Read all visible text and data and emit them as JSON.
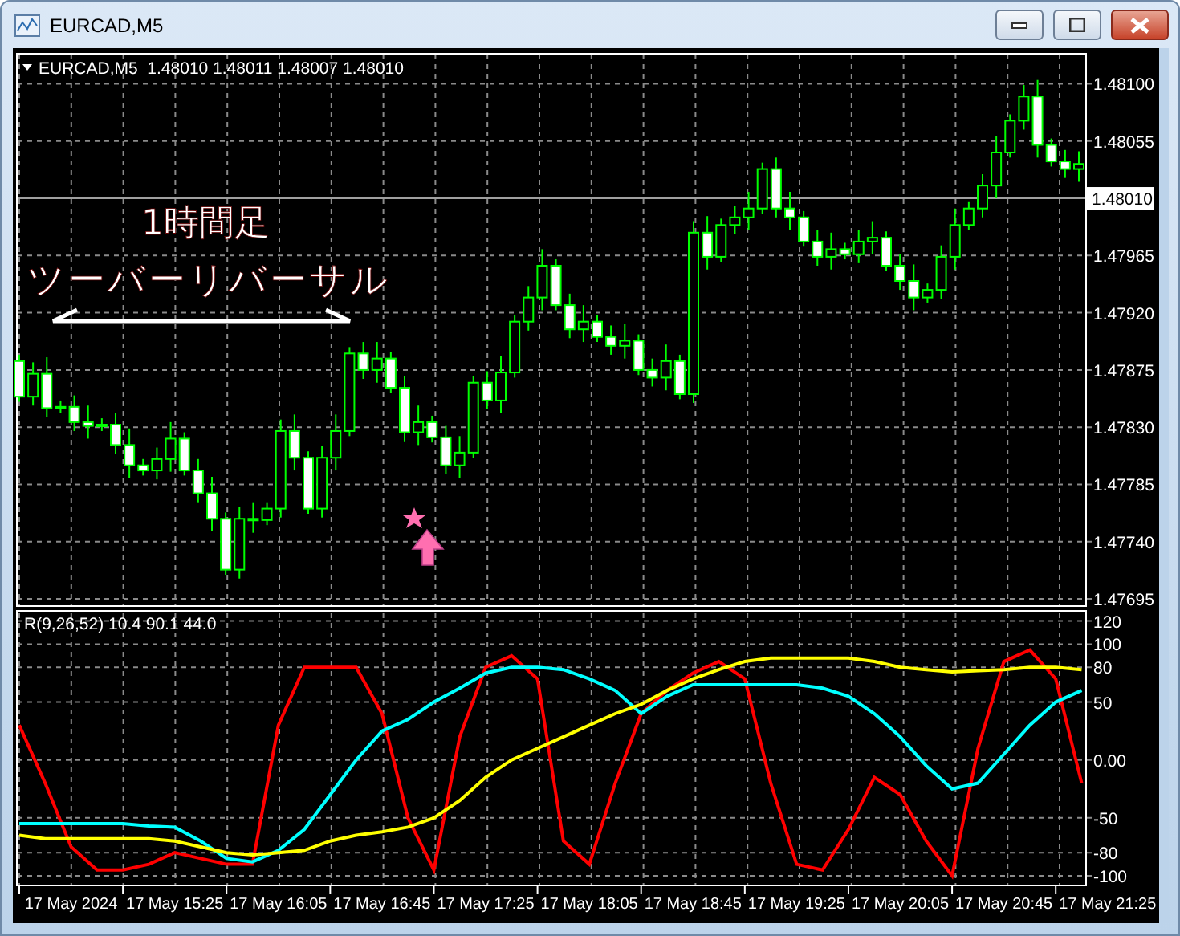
{
  "window": {
    "title": "EURCAD,M5"
  },
  "price_chart": {
    "header": "EURCAD,M5  1.48010 1.48011 1.48007 1.48010",
    "annotation_title": "1時間足",
    "annotation_caption": "ツーバーリバーサル",
    "chart_data": {
      "type": "candlestick",
      "categories": [
        null,
        null,
        null,
        null,
        null,
        null,
        null,
        null,
        null,
        null,
        null,
        null,
        null,
        null,
        null,
        null,
        null,
        null,
        null,
        null,
        null,
        null,
        null,
        null,
        null,
        null,
        null,
        null,
        null,
        null,
        null,
        null,
        null,
        null,
        null,
        null,
        null,
        null,
        null,
        null,
        null,
        null,
        null,
        null,
        null,
        null,
        null,
        null,
        null,
        null,
        null,
        null,
        null,
        null,
        null,
        null,
        null,
        null,
        null,
        null,
        null,
        null,
        null,
        null,
        null,
        null,
        null,
        null,
        null,
        null,
        null,
        null,
        null,
        null,
        null,
        null,
        null,
        null
      ],
      "grid": true,
      "ylim": [
        1.4769,
        1.48123
      ],
      "yticks": [
        {
          "value": 1.481,
          "label": "1.48100"
        },
        {
          "value": 1.48055,
          "label": "1.48055"
        },
        {
          "value": 1.47965,
          "label": "1.47965"
        },
        {
          "value": 1.4792,
          "label": "1.47920"
        },
        {
          "value": 1.47875,
          "label": "1.47875"
        },
        {
          "value": 1.4783,
          "label": "1.47830"
        },
        {
          "value": 1.47785,
          "label": "1.47785"
        },
        {
          "value": 1.4774,
          "label": "1.47740"
        },
        {
          "value": 1.47695,
          "label": "1.47695"
        }
      ],
      "ohlc": [
        [
          1.47882,
          1.47887,
          1.4785,
          1.47854
        ],
        [
          1.47854,
          1.47881,
          1.47847,
          1.47872
        ],
        [
          1.47872,
          1.47885,
          1.47838,
          1.47845
        ],
        [
          1.47845,
          1.47851,
          1.47841,
          1.47846
        ],
        [
          1.47846,
          1.47855,
          1.47827,
          1.47834
        ],
        [
          1.47834,
          1.47847,
          1.47821,
          1.47831
        ],
        [
          1.47831,
          1.47837,
          1.47827,
          1.47832
        ],
        [
          1.47832,
          1.47841,
          1.47809,
          1.47816
        ],
        [
          1.47816,
          1.47829,
          1.4779,
          1.478
        ],
        [
          1.478,
          1.47805,
          1.47792,
          1.47796
        ],
        [
          1.47796,
          1.47814,
          1.47789,
          1.47805
        ],
        [
          1.47805,
          1.47834,
          1.47795,
          1.47821
        ],
        [
          1.47821,
          1.47826,
          1.47792,
          1.47796
        ],
        [
          1.47796,
          1.47805,
          1.47771,
          1.47778
        ],
        [
          1.47778,
          1.47791,
          1.47748,
          1.47758
        ],
        [
          1.47758,
          1.47763,
          1.47714,
          1.47718
        ],
        [
          1.47718,
          1.47767,
          1.47711,
          1.47758
        ],
        [
          1.47758,
          1.47771,
          1.47747,
          1.47757
        ],
        [
          1.47757,
          1.47771,
          1.47753,
          1.47766
        ],
        [
          1.47766,
          1.47836,
          1.47759,
          1.47827
        ],
        [
          1.47827,
          1.4784,
          1.47796,
          1.47806
        ],
        [
          1.47806,
          1.47811,
          1.47762,
          1.47766
        ],
        [
          1.47766,
          1.47815,
          1.47759,
          1.47806
        ],
        [
          1.47806,
          1.4784,
          1.47796,
          1.47827
        ],
        [
          1.47827,
          1.47893,
          1.47823,
          1.47888
        ],
        [
          1.47888,
          1.47897,
          1.47868,
          1.47875
        ],
        [
          1.47875,
          1.47897,
          1.47865,
          1.47884
        ],
        [
          1.47884,
          1.47889,
          1.47857,
          1.47861
        ],
        [
          1.47861,
          1.4787,
          1.47819,
          1.47826
        ],
        [
          1.47826,
          1.47847,
          1.47816,
          1.47834
        ],
        [
          1.47834,
          1.47839,
          1.47818,
          1.47822
        ],
        [
          1.47822,
          1.47831,
          1.47793,
          1.478
        ],
        [
          1.478,
          1.47823,
          1.4779,
          1.4781
        ],
        [
          1.4781,
          1.4787,
          1.47806,
          1.47865
        ],
        [
          1.47865,
          1.47874,
          1.47844,
          1.47851
        ],
        [
          1.47851,
          1.47886,
          1.47841,
          1.47873
        ],
        [
          1.47873,
          1.47918,
          1.47869,
          1.47913
        ],
        [
          1.47913,
          1.47941,
          1.47906,
          1.47932
        ],
        [
          1.47932,
          1.4797,
          1.47922,
          1.47957
        ],
        [
          1.47957,
          1.47962,
          1.47922,
          1.47926
        ],
        [
          1.47926,
          1.47935,
          1.479,
          1.47907
        ],
        [
          1.47907,
          1.47926,
          1.47897,
          1.47913
        ],
        [
          1.47913,
          1.47918,
          1.47897,
          1.47901
        ],
        [
          1.47901,
          1.4791,
          1.47887,
          1.47894
        ],
        [
          1.47894,
          1.47911,
          1.47884,
          1.47898
        ],
        [
          1.47898,
          1.47903,
          1.47871,
          1.47875
        ],
        [
          1.47875,
          1.47884,
          1.47862,
          1.47869
        ],
        [
          1.47869,
          1.47895,
          1.47859,
          1.47882
        ],
        [
          1.47882,
          1.47887,
          1.47852,
          1.47856
        ],
        [
          1.47856,
          1.47992,
          1.47849,
          1.47983
        ],
        [
          1.47983,
          1.47996,
          1.47954,
          1.47964
        ],
        [
          1.47964,
          1.47994,
          1.4796,
          1.47989
        ],
        [
          1.47989,
          1.48004,
          1.47982,
          1.47995
        ],
        [
          1.47995,
          1.48015,
          1.47985,
          1.48002
        ],
        [
          1.48002,
          1.48038,
          1.47998,
          1.48033
        ],
        [
          1.48033,
          1.48042,
          1.47995,
          1.48002
        ],
        [
          1.48002,
          1.48015,
          1.47985,
          1.47995
        ],
        [
          1.47995,
          1.48,
          1.47972,
          1.47976
        ],
        [
          1.47976,
          1.47985,
          1.47957,
          1.47964
        ],
        [
          1.47964,
          1.47983,
          1.47954,
          1.4797
        ],
        [
          1.4797,
          1.47975,
          1.47962,
          1.47966
        ],
        [
          1.47966,
          1.47985,
          1.47959,
          1.47976
        ],
        [
          1.47976,
          1.47992,
          1.47966,
          1.47979
        ],
        [
          1.47979,
          1.47984,
          1.47953,
          1.47957
        ],
        [
          1.47957,
          1.47966,
          1.47938,
          1.47945
        ],
        [
          1.47945,
          1.47958,
          1.47922,
          1.47932
        ],
        [
          1.47932,
          1.47943,
          1.47928,
          1.47938
        ],
        [
          1.47938,
          1.47973,
          1.47931,
          1.47964
        ],
        [
          1.47964,
          1.48002,
          1.47954,
          1.47989
        ],
        [
          1.47989,
          1.48007,
          1.47985,
          1.48002
        ],
        [
          1.48002,
          1.48029,
          1.47995,
          1.4802
        ],
        [
          1.4802,
          1.48059,
          1.4801,
          1.48046
        ],
        [
          1.48046,
          1.48076,
          1.48042,
          1.48071
        ],
        [
          1.48071,
          1.48099,
          1.48064,
          1.4809
        ],
        [
          1.4809,
          1.48103,
          1.48042,
          1.48052
        ],
        [
          1.48052,
          1.48057,
          1.48035,
          1.48039
        ],
        [
          1.48039,
          1.48048,
          1.48026,
          1.48033
        ],
        [
          1.48033,
          1.48047,
          1.48023,
          1.48037
        ]
      ],
      "ref_lines": [
        {
          "axis": "y",
          "value": 1.4801,
          "label": "1.48010"
        }
      ]
    }
  },
  "indicator": {
    "label": "R(9,26,52) 10.4 90.1 44.0",
    "chart_data": {
      "type": "line",
      "categories": [
        null,
        null,
        "17 May 2024",
        null,
        null,
        null,
        "17 May 15:25",
        null,
        null,
        null,
        "17 May 16:05",
        null,
        null,
        null,
        "17 May 16:45",
        null,
        null,
        null,
        "17 May 17:25",
        null,
        null,
        null,
        "17 May 18:05",
        null,
        null,
        null,
        "17 May 18:45",
        null,
        null,
        null,
        "17 May 19:25",
        null,
        null,
        null,
        "17 May 20:05",
        null,
        null,
        null,
        "17 May 20:45",
        null,
        null,
        null,
        "17 May 21:25"
      ],
      "grid": true,
      "series": [
        {
          "color": "#ff0000",
          "values": [
            30,
            -20,
            -75,
            -95,
            -95,
            -90,
            -80,
            -85,
            -90,
            -90,
            30,
            80,
            80,
            80,
            40,
            -50,
            -95,
            20,
            80,
            90,
            70,
            -70,
            -90,
            -20,
            40,
            60,
            75,
            85,
            70,
            -20,
            -90,
            -95,
            -60,
            -15,
            -30,
            -70,
            -100,
            10,
            85,
            95,
            70,
            -20,
            null
          ]
        },
        {
          "color": "#00ffff",
          "values": [
            -55,
            -55,
            -55,
            -55,
            -55,
            -57,
            -58,
            -70,
            -85,
            -88,
            -78,
            -60,
            -30,
            0,
            25,
            35,
            50,
            62,
            75,
            80,
            80,
            78,
            70,
            60,
            40,
            55,
            65,
            65,
            65,
            65,
            65,
            62,
            55,
            40,
            20,
            -5,
            -25,
            -20,
            5,
            30,
            50,
            60,
            null
          ]
        },
        {
          "color": "#ffff00",
          "values": [
            -65,
            -68,
            -68,
            -68,
            -68,
            -68,
            -70,
            -75,
            -80,
            -82,
            -80,
            -78,
            -70,
            -65,
            -62,
            -58,
            -50,
            -35,
            -15,
            0,
            10,
            20,
            30,
            40,
            48,
            60,
            70,
            78,
            85,
            88,
            88,
            88,
            88,
            85,
            80,
            78,
            76,
            77,
            78,
            80,
            80,
            78,
            null
          ]
        }
      ],
      "ylim": [
        -109,
        128
      ],
      "yticks": [
        120,
        100,
        80,
        50,
        {
          "value": 0,
          "label": "0.00"
        },
        -50,
        -80,
        -100
      ]
    }
  }
}
